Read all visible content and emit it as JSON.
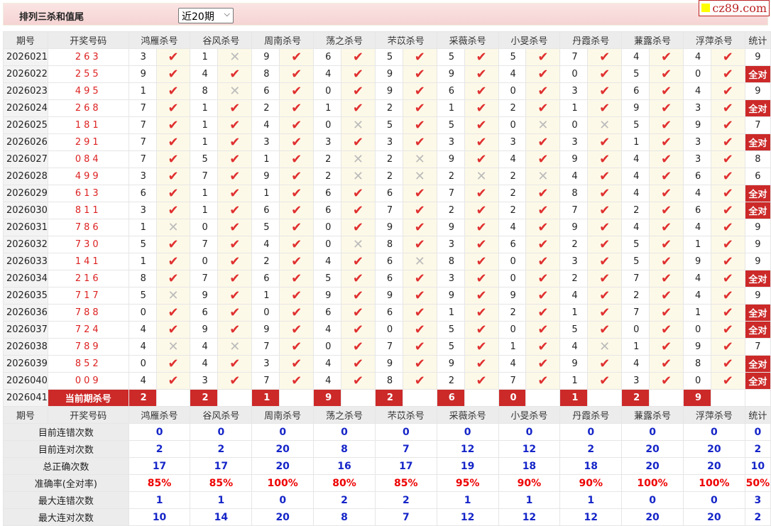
{
  "header": {
    "title": "排列三杀和值尾",
    "period_select": "近20期",
    "logo": "cz89.com"
  },
  "columns": {
    "issue": "期号",
    "number": "开奖号码",
    "stat": "统计",
    "predictors": [
      "鸿雁杀号",
      "谷风杀号",
      "周南杀号",
      "荡之杀号",
      "芣苡杀号",
      "采薇杀号",
      "小旻杀号",
      "丹霞杀号",
      "蒹露杀号",
      "浮萍杀号"
    ]
  },
  "rows": [
    {
      "issue": "2026021",
      "number": "263",
      "kills": [
        "3",
        "1",
        "9",
        "6",
        "5",
        "5",
        "5",
        "7",
        "4",
        "4"
      ],
      "ok": [
        1,
        0,
        1,
        1,
        1,
        1,
        1,
        1,
        1,
        1
      ],
      "stat": "9"
    },
    {
      "issue": "2026022",
      "number": "255",
      "kills": [
        "9",
        "4",
        "8",
        "4",
        "9",
        "9",
        "4",
        "0",
        "5",
        "0"
      ],
      "ok": [
        1,
        1,
        1,
        1,
        1,
        1,
        1,
        1,
        1,
        1
      ],
      "stat": "全对"
    },
    {
      "issue": "2026023",
      "number": "495",
      "kills": [
        "1",
        "8",
        "6",
        "0",
        "9",
        "6",
        "0",
        "3",
        "6",
        "4"
      ],
      "ok": [
        1,
        0,
        1,
        1,
        1,
        1,
        1,
        1,
        1,
        1
      ],
      "stat": "9"
    },
    {
      "issue": "2026024",
      "number": "268",
      "kills": [
        "7",
        "1",
        "2",
        "1",
        "2",
        "1",
        "2",
        "1",
        "9",
        "3"
      ],
      "ok": [
        1,
        1,
        1,
        1,
        1,
        1,
        1,
        1,
        1,
        1
      ],
      "stat": "全对"
    },
    {
      "issue": "2026025",
      "number": "181",
      "kills": [
        "7",
        "1",
        "4",
        "0",
        "5",
        "5",
        "0",
        "0",
        "5",
        "9"
      ],
      "ok": [
        1,
        1,
        1,
        0,
        1,
        1,
        0,
        0,
        1,
        1
      ],
      "stat": "7"
    },
    {
      "issue": "2026026",
      "number": "291",
      "kills": [
        "7",
        "1",
        "3",
        "3",
        "3",
        "3",
        "3",
        "3",
        "1",
        "3"
      ],
      "ok": [
        1,
        1,
        1,
        1,
        1,
        1,
        1,
        1,
        1,
        1
      ],
      "stat": "全对"
    },
    {
      "issue": "2026027",
      "number": "084",
      "kills": [
        "7",
        "5",
        "1",
        "2",
        "2",
        "9",
        "4",
        "9",
        "4",
        "3"
      ],
      "ok": [
        1,
        1,
        1,
        0,
        0,
        1,
        1,
        1,
        1,
        1
      ],
      "stat": "8"
    },
    {
      "issue": "2026028",
      "number": "499",
      "kills": [
        "3",
        "7",
        "9",
        "2",
        "2",
        "2",
        "2",
        "4",
        "4",
        "6"
      ],
      "ok": [
        1,
        1,
        1,
        0,
        0,
        0,
        0,
        1,
        1,
        1
      ],
      "stat": "6"
    },
    {
      "issue": "2026029",
      "number": "613",
      "kills": [
        "6",
        "1",
        "1",
        "6",
        "6",
        "7",
        "2",
        "8",
        "4",
        "4"
      ],
      "ok": [
        1,
        1,
        1,
        1,
        1,
        1,
        1,
        1,
        1,
        1
      ],
      "stat": "全对"
    },
    {
      "issue": "2026030",
      "number": "811",
      "kills": [
        "3",
        "1",
        "6",
        "6",
        "7",
        "2",
        "2",
        "7",
        "2",
        "6"
      ],
      "ok": [
        1,
        1,
        1,
        1,
        1,
        1,
        1,
        1,
        1,
        1
      ],
      "stat": "全对"
    },
    {
      "issue": "2026031",
      "number": "786",
      "kills": [
        "1",
        "0",
        "5",
        "0",
        "9",
        "9",
        "4",
        "9",
        "4",
        "4"
      ],
      "ok": [
        0,
        1,
        1,
        1,
        1,
        1,
        1,
        1,
        1,
        1
      ],
      "stat": "9"
    },
    {
      "issue": "2026032",
      "number": "730",
      "kills": [
        "5",
        "7",
        "4",
        "0",
        "8",
        "3",
        "6",
        "2",
        "5",
        "1"
      ],
      "ok": [
        1,
        1,
        1,
        0,
        1,
        1,
        1,
        1,
        1,
        1
      ],
      "stat": "9"
    },
    {
      "issue": "2026033",
      "number": "141",
      "kills": [
        "1",
        "0",
        "2",
        "4",
        "6",
        "8",
        "0",
        "3",
        "5",
        "9"
      ],
      "ok": [
        1,
        1,
        1,
        1,
        0,
        1,
        1,
        1,
        1,
        1
      ],
      "stat": "9"
    },
    {
      "issue": "2026034",
      "number": "216",
      "kills": [
        "8",
        "7",
        "6",
        "5",
        "6",
        "3",
        "0",
        "2",
        "7",
        "4"
      ],
      "ok": [
        1,
        1,
        1,
        1,
        1,
        1,
        1,
        1,
        1,
        1
      ],
      "stat": "全对"
    },
    {
      "issue": "2026035",
      "number": "717",
      "kills": [
        "5",
        "9",
        "1",
        "9",
        "9",
        "9",
        "9",
        "4",
        "2",
        "4"
      ],
      "ok": [
        0,
        1,
        1,
        1,
        1,
        1,
        1,
        1,
        1,
        1
      ],
      "stat": "9"
    },
    {
      "issue": "2026036",
      "number": "788",
      "kills": [
        "0",
        "6",
        "0",
        "6",
        "6",
        "1",
        "2",
        "1",
        "7",
        "1"
      ],
      "ok": [
        1,
        1,
        1,
        1,
        1,
        1,
        1,
        1,
        1,
        1
      ],
      "stat": "全对"
    },
    {
      "issue": "2026037",
      "number": "724",
      "kills": [
        "4",
        "9",
        "9",
        "4",
        "0",
        "5",
        "0",
        "5",
        "0",
        "0"
      ],
      "ok": [
        1,
        1,
        1,
        1,
        1,
        1,
        1,
        1,
        1,
        1
      ],
      "stat": "全对"
    },
    {
      "issue": "2026038",
      "number": "789",
      "kills": [
        "4",
        "4",
        "7",
        "0",
        "7",
        "5",
        "1",
        "4",
        "1",
        "9"
      ],
      "ok": [
        0,
        0,
        1,
        1,
        1,
        1,
        1,
        0,
        1,
        1
      ],
      "stat": "7"
    },
    {
      "issue": "2026039",
      "number": "852",
      "kills": [
        "0",
        "4",
        "3",
        "4",
        "9",
        "9",
        "4",
        "9",
        "4",
        "8"
      ],
      "ok": [
        1,
        1,
        1,
        1,
        1,
        1,
        1,
        1,
        1,
        1
      ],
      "stat": "全对"
    },
    {
      "issue": "2026040",
      "number": "009",
      "kills": [
        "4",
        "3",
        "7",
        "4",
        "8",
        "2",
        "7",
        "1",
        "3",
        "0"
      ],
      "ok": [
        1,
        1,
        1,
        1,
        1,
        1,
        1,
        1,
        1,
        1
      ],
      "stat": "全对"
    }
  ],
  "current": {
    "issue": "2026041",
    "label": "当前期杀号",
    "kills": [
      "2",
      "2",
      "1",
      "9",
      "2",
      "6",
      "0",
      "1",
      "2",
      "9"
    ]
  },
  "summary": [
    {
      "label": "目前连错次数",
      "values": [
        "0",
        "0",
        "0",
        "0",
        "0",
        "0",
        "0",
        "0",
        "0",
        "0"
      ],
      "stat": "0",
      "red": false
    },
    {
      "label": "目前连对次数",
      "values": [
        "2",
        "2",
        "20",
        "8",
        "7",
        "12",
        "12",
        "2",
        "20",
        "20"
      ],
      "stat": "2",
      "red": false
    },
    {
      "label": "总正确次数",
      "values": [
        "17",
        "17",
        "20",
        "16",
        "17",
        "19",
        "18",
        "18",
        "20",
        "20"
      ],
      "stat": "10",
      "red": false
    },
    {
      "label": "准确率(全对率)",
      "values": [
        "85%",
        "85%",
        "100%",
        "80%",
        "85%",
        "95%",
        "90%",
        "90%",
        "100%",
        "100%"
      ],
      "stat": "50%",
      "red": true
    },
    {
      "label": "最大连错次数",
      "values": [
        "1",
        "1",
        "0",
        "2",
        "2",
        "1",
        "1",
        "1",
        "0",
        "0"
      ],
      "stat": "3",
      "red": false
    },
    {
      "label": "最大连对次数",
      "values": [
        "10",
        "14",
        "20",
        "8",
        "7",
        "12",
        "12",
        "12",
        "20",
        "20"
      ],
      "stat": "2",
      "red": false
    }
  ]
}
